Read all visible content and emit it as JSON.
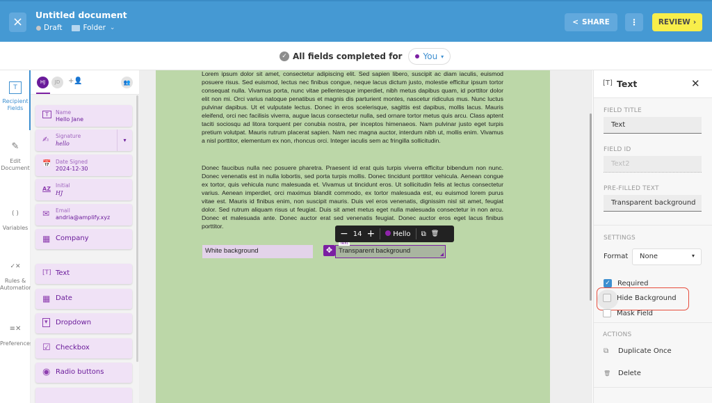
{
  "header": {
    "close_icon": "×",
    "title": "Untitled document",
    "status": "Draft",
    "folder": "Folder",
    "share_label": "SHARE",
    "more_icon": "⋮",
    "review_label": "REVIEW",
    "review_chevron": "›"
  },
  "status_bar": {
    "check_icon": "✓",
    "message": "All fields completed for",
    "recipient": "You",
    "caret": "▾"
  },
  "left_nav": {
    "items": [
      {
        "label": "Recipient Fields",
        "icon": "[T]",
        "active": true
      },
      {
        "label": "Edit Document",
        "icon": "✎"
      },
      {
        "label": "Variables",
        "icon": "( )"
      },
      {
        "label": "Rules & Automation",
        "icon": "✓✕"
      },
      {
        "label": "Preferences",
        "icon": "≡✕"
      }
    ]
  },
  "recipients": {
    "avatars": [
      {
        "initials": "HJ",
        "active": true
      },
      {
        "initials": "JD"
      }
    ],
    "add_icon": "+👤",
    "settings_icon": "👥"
  },
  "filled_fields": [
    {
      "label": "Name",
      "value": "Hello Jane",
      "icon": "T"
    },
    {
      "label": "Signature",
      "value": "hello",
      "icon": "✍",
      "has_dropdown": true,
      "dropdown_icon": "▾"
    },
    {
      "label": "Date Signed",
      "value": "2024-12-30",
      "icon": "📅"
    },
    {
      "label": "Initial",
      "value": "HJ",
      "icon": "AZ"
    },
    {
      "label": "Email",
      "value": "andria@amplify.xyz",
      "icon": "✉"
    },
    {
      "label": "Company",
      "icon": "▦"
    }
  ],
  "standard_fields": [
    {
      "label": "Text",
      "icon": "[T]"
    },
    {
      "label": "Date",
      "icon": "▦"
    },
    {
      "label": "Dropdown",
      "icon": "▾"
    },
    {
      "label": "Checkbox",
      "icon": "☑"
    },
    {
      "label": "Radio buttons",
      "icon": "◉"
    }
  ],
  "document": {
    "paragraph1": "Lorem ipsum dolor sit amet, consectetur adipiscing elit. Sed sapien libero, suscipit ac diam iaculis, euismod posuere risus. Sed euismod, lectus nec finibus congue, neque lacus dictum justo, molestie efficitur ipsum tortor consequat nulla. Vivamus porta, nunc vitae pellentesque imperdiet, nibh metus dapibus quam, id porttitor dolor elit non mi. Orci varius natoque penatibus et magnis dis parturient montes, nascetur ridiculus mus. Nunc luctus pulvinar dapibus. Ut et vulputate lectus. Donec in eros scelerisque, sagittis est dapibus, mollis lacus. Mauris eleifend, orci nec facilisis viverra, augue lacus consectetur nulla, sed ornare tortor metus quis arcu. Class aptent taciti sociosqu ad litora torquent per conubia nostra, per inceptos himenaeos. Nam pulvinar justo eget turpis pretium volutpat. Mauris rutrum placerat sapien. Nam nec magna auctor, interdum nibh ut, mollis enim. Vivamus a nisl porttitor, elementum ex non, rhoncus orci. Integer iaculis sem ac fringilla sollicitudin.",
    "paragraph2": "Donec faucibus nulla nec posuere pharetra. Praesent id erat quis turpis viverra efficitur bibendum non nunc. Donec venenatis est in nulla lobortis, sed porta turpis mollis. Donec tincidunt porttitor vehicula. Aenean congue ex tortor, quis vehicula nunc malesuada et. Vivamus ut tincidunt eros. Ut sollicitudin felis at lectus consectetur varius. Aenean imperdiet, orci maximus blandit commodo, ex tortor malesuada est, eu euismod lorem purus vitae est. Mauris id finibus enim, non suscipit mauris. Duis vel eros venenatis, dignissim nisl sit amet, feugiat dolor. Sed rutrum aliquam risus ut feugiat. Duis sit amet metus eget nulla malesuada consectetur in non arcu. Donec et malesuada ante. Donec auctor erat sed venenatis feugiat. Donec auctor eros eget lacus finibus porttitor.",
    "white_field": "White background",
    "transparent_field": "Transparent background",
    "transparent_field_tag": "Text",
    "move_icon": "✥"
  },
  "field_toolbar": {
    "minus": "−",
    "font_size": "14",
    "plus": "+",
    "assignee": "Hello",
    "copy_icon": "⧉",
    "delete_icon": "🗑"
  },
  "properties": {
    "title_icon": "[T]",
    "title": "Text",
    "close_icon": "✕",
    "field_title_label": "FIELD TITLE",
    "field_title_value": "Text",
    "field_id_label": "FIELD ID",
    "field_id_placeholder": "Text2",
    "prefilled_label": "PRE-FILLED TEXT",
    "prefilled_value": "Transparent background",
    "settings_label": "SETTINGS",
    "format_label": "Format",
    "format_value": "None",
    "format_caret": "▾",
    "checkboxes": [
      {
        "label": "Required",
        "checked": true
      },
      {
        "label": "Hide Background",
        "checked": false
      },
      {
        "label": "Mask Field",
        "checked": false
      }
    ],
    "actions_label": "ACTIONS",
    "actions": [
      {
        "label": "Duplicate Once",
        "icon": "⧉"
      },
      {
        "label": "Delete",
        "icon": "🗑"
      }
    ]
  },
  "colors": {
    "header_blue": "#4599d3",
    "review_yellow": "#f8ee4a",
    "brand_purple": "#7b1fa2",
    "field_card_bg": "#f0e2f6",
    "page_green": "#bcd7a8",
    "highlight_red": "#e74c3c"
  }
}
